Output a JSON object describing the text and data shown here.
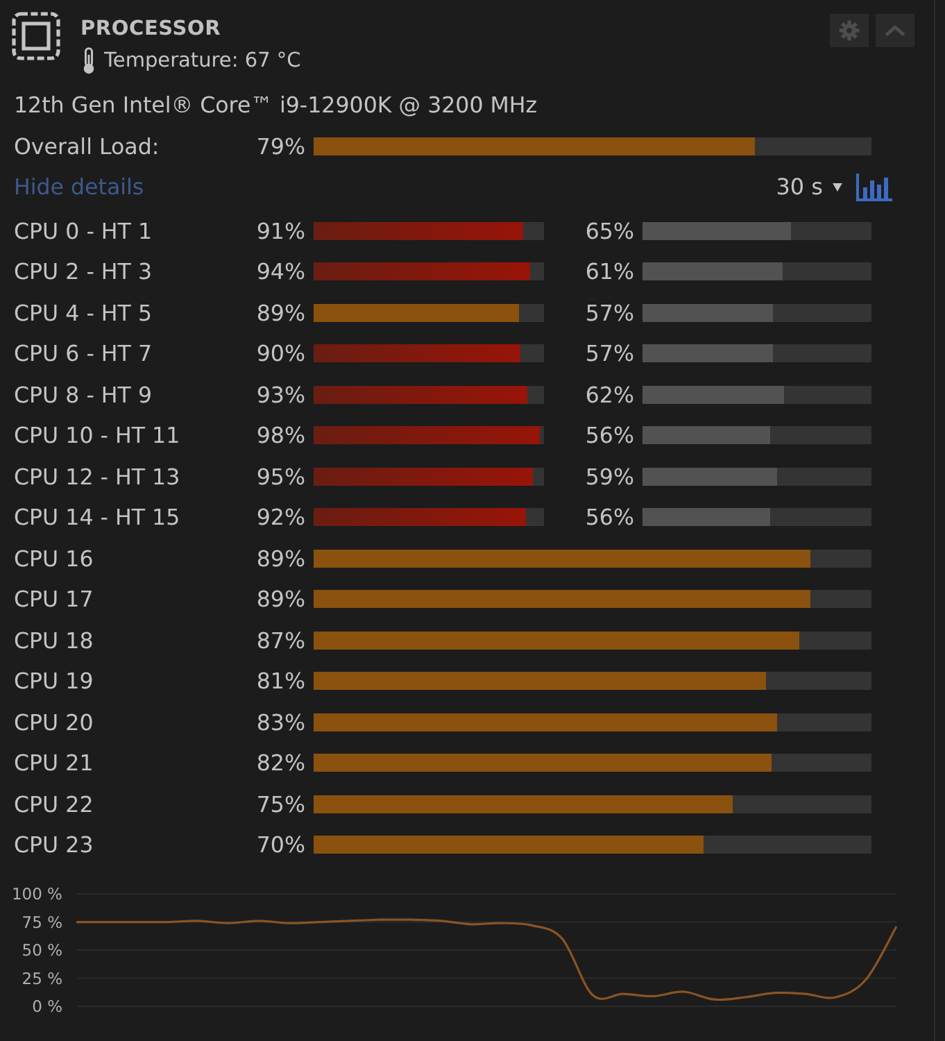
{
  "header": {
    "title": "PROCESSOR",
    "temperature": "Temperature: 67 °C"
  },
  "cpu_name": "12th Gen Intel® Core™ i9-12900K @ 3200 MHz",
  "overall_load": {
    "label": "Overall Load:",
    "reading": "79%",
    "level": 0.79,
    "critical": false
  },
  "details_link": "Hide details",
  "history_interval": "30 s",
  "cores": [
    {
      "label": "CPU 0 - HT 1",
      "kind": "pair",
      "load": {
        "reading": "91%",
        "level": 0.91,
        "critical": true
      },
      "ht_load": {
        "reading": "65%",
        "level": 0.65
      }
    },
    {
      "label": "CPU 2 - HT 3",
      "kind": "pair",
      "load": {
        "reading": "94%",
        "level": 0.94,
        "critical": true
      },
      "ht_load": {
        "reading": "61%",
        "level": 0.61
      }
    },
    {
      "label": "CPU 4 - HT 5",
      "kind": "pair",
      "load": {
        "reading": "89%",
        "level": 0.89,
        "critical": false
      },
      "ht_load": {
        "reading": "57%",
        "level": 0.57
      }
    },
    {
      "label": "CPU 6 - HT 7",
      "kind": "pair",
      "load": {
        "reading": "90%",
        "level": 0.9,
        "critical": true
      },
      "ht_load": {
        "reading": "57%",
        "level": 0.57
      }
    },
    {
      "label": "CPU 8 - HT 9",
      "kind": "pair",
      "load": {
        "reading": "93%",
        "level": 0.93,
        "critical": true
      },
      "ht_load": {
        "reading": "62%",
        "level": 0.62
      }
    },
    {
      "label": "CPU 10 - HT 11",
      "kind": "pair",
      "load": {
        "reading": "98%",
        "level": 0.98,
        "critical": true
      },
      "ht_load": {
        "reading": "56%",
        "level": 0.56
      }
    },
    {
      "label": "CPU 12 - HT 13",
      "kind": "pair",
      "load": {
        "reading": "95%",
        "level": 0.95,
        "critical": true
      },
      "ht_load": {
        "reading": "59%",
        "level": 0.59
      }
    },
    {
      "label": "CPU 14 - HT 15",
      "kind": "pair",
      "load": {
        "reading": "92%",
        "level": 0.92,
        "critical": true
      },
      "ht_load": {
        "reading": "56%",
        "level": 0.56
      }
    },
    {
      "label": "CPU 16",
      "kind": "single",
      "load": {
        "reading": "89%",
        "level": 0.89,
        "critical": false
      }
    },
    {
      "label": "CPU 17",
      "kind": "single",
      "load": {
        "reading": "89%",
        "level": 0.89,
        "critical": false
      }
    },
    {
      "label": "CPU 18",
      "kind": "single",
      "load": {
        "reading": "87%",
        "level": 0.87,
        "critical": false
      }
    },
    {
      "label": "CPU 19",
      "kind": "single",
      "load": {
        "reading": "81%",
        "level": 0.81,
        "critical": false
      }
    },
    {
      "label": "CPU 20",
      "kind": "single",
      "load": {
        "reading": "83%",
        "level": 0.83,
        "critical": false
      }
    },
    {
      "label": "CPU 21",
      "kind": "single",
      "load": {
        "reading": "82%",
        "level": 0.82,
        "critical": false
      }
    },
    {
      "label": "CPU 22",
      "kind": "single",
      "load": {
        "reading": "75%",
        "level": 0.75,
        "critical": false
      }
    },
    {
      "label": "CPU 23",
      "kind": "single",
      "load": {
        "reading": "70%",
        "level": 0.7,
        "critical": false
      }
    }
  ],
  "history_chart": {
    "chart_data": {
      "type": "line",
      "grid": true,
      "ylim": [
        0,
        100
      ],
      "yticks": [
        {
          "value": 100,
          "label": "100 %"
        },
        {
          "value": 75,
          "label": "75 %"
        },
        {
          "value": 50,
          "label": "50 %"
        },
        {
          "value": 25,
          "label": "25 %"
        },
        {
          "value": 0,
          "label": "0 %"
        }
      ],
      "values": [
        75,
        75,
        75,
        75,
        76,
        74,
        76,
        74,
        75,
        76,
        77,
        77,
        76,
        73,
        74,
        72,
        60,
        10,
        11,
        9,
        13,
        6,
        8,
        12,
        11,
        8,
        24,
        71
      ]
    }
  }
}
